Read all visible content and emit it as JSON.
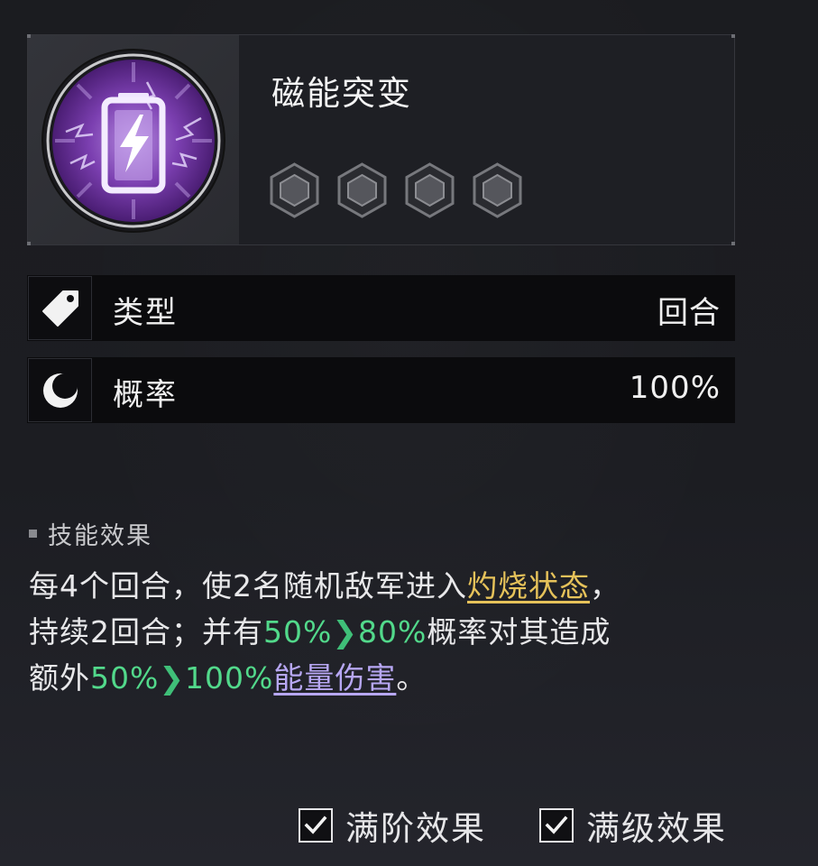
{
  "skill": {
    "name": "磁能突变",
    "icon": "lightning-battery-icon",
    "star_count": 4,
    "star_icon": "hexagon-star-icon"
  },
  "attributes": [
    {
      "icon": "tag-icon",
      "label": "类型",
      "value": "回合"
    },
    {
      "icon": "moon-icon",
      "label": "概率",
      "value": "100%"
    }
  ],
  "description": {
    "section_title": "技能效果",
    "text": {
      "p1": "每4个回合，使2名随机敌军进入",
      "kw_burn": "灼烧状态",
      "p2": "，",
      "p3": "持续2回合；并有",
      "v1_from": "50%",
      "v1_to": "80%",
      "p4": "概率对其造成",
      "p5": "额外",
      "v2_from": "50%",
      "v2_to": "100%",
      "kw_energy": "能量伤害",
      "p6": "。"
    }
  },
  "options": [
    {
      "label": "满阶效果",
      "checked": true
    },
    {
      "label": "满级效果",
      "checked": true
    }
  ],
  "colors": {
    "burn_keyword": "#e6c25a",
    "energy_keyword": "#b7a7f3",
    "upgrade_value": "#52d98b",
    "icon_purple": "#7b3fb0"
  }
}
